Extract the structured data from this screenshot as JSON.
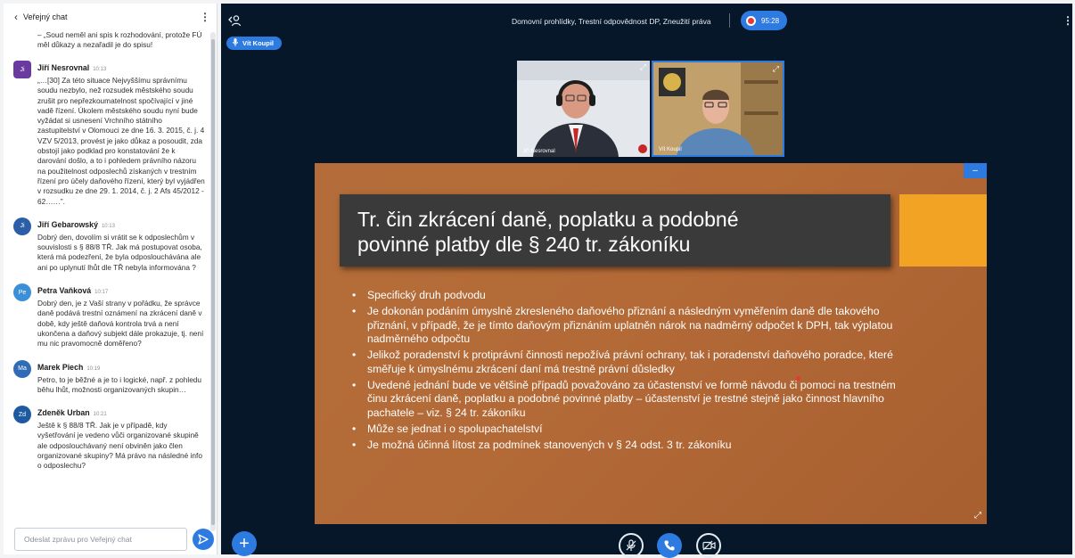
{
  "chat": {
    "title": "Veřejný chat",
    "top_text": "– „Soud neměl ani spis k rozhodování, protože FÚ měl důkazy a nezařadil je do spisu!",
    "messages": [
      {
        "initials": "Ji",
        "name": "Jiří Nesrovnal",
        "time": "10:13",
        "color": "#6b3aa0",
        "text": "„…[30] Za této situace Nejvyššímu správnímu soudu nezbylo, než rozsudek městského soudu zrušit pro nepřezkoumatelnost spočívající v jiné vadě řízení. Úkolem městského soudu nyní bude vyžádat si usnesení Vrchního státního zastupitelství v Olomouci ze dne 16. 3. 2015, č. j. 4 VZV 5/2013, provést je jako důkaz a posoudit, zda obstojí jako podklad pro konstatování že k darování došlo, a to i pohledem právního názoru na použitelnost odposlechů získaných v trestním řízení pro účely daňového řízení, který byl vyjádřen v rozsudku ze dne 29. 1. 2014, č. j. 2 Afs 45/2012 - 62……”."
      },
      {
        "initials": "Ji",
        "name": "Jiří Gebarowský",
        "time": "10:13",
        "color": "#2a5fa8",
        "text": "Dobrý den, dovolím si vrátit se k odposlechům v souvislosti s § 88/8 TŘ. Jak má postupovat osoba, která má podezření, že byla odposlouchávána ale ani po uplynutí lhůt dle TŘ nebyla informována ?"
      },
      {
        "initials": "Pe",
        "name": "Petra Vaňková",
        "time": "10:17",
        "color": "#3a8fd6",
        "text": "Dobrý den, je z Vaší strany v pořádku, že správce daně podává trestní oznámení na zkrácení daně v době, kdy ještě daňová kontrola trvá a není ukončena a daňový subjekt dále prokazuje, tj. není mu nic pravomocně doměřeno?"
      },
      {
        "initials": "Ma",
        "name": "Marek Piech",
        "time": "10:19",
        "color": "#2f6cb5",
        "text": "Petro, to je běžné a je to i logické, např. z pohledu běhu lhůt, možnosti organizovaných skupin…"
      },
      {
        "initials": "Zd",
        "name": "Zdeněk Urban",
        "time": "10:21",
        "color": "#1e5aa0",
        "text": "Ještě k § 88/8 TŘ. Jak je v případě, kdy vyšetřování je vedeno vůči organizované skupině ale odposlouchávaný není obviněn jako člen organizované skupiny? Má právo na následné info o odposlechu?"
      }
    ],
    "input_placeholder": "Odeslat zprávu pro Veřejný chat",
    "icons": {
      "back": "chevron-left-icon",
      "menu": "kebab-menu-icon",
      "send": "send-icon"
    }
  },
  "topbar": {
    "title": "Domovní prohlídky, Trestní odpovědnost DP, Zneužití práva",
    "recording_time": "95:28",
    "talking_user": "Vít Koupil"
  },
  "webcams": [
    {
      "name": "Jiří Nesrovnal"
    },
    {
      "name": "Vít Koupil"
    }
  ],
  "slide": {
    "title_line1": "Tr. čin zkrácení daně, poplatku a podobné",
    "title_line2": "povinné platby dle § 240 tr. zákoníku",
    "bullets": [
      "Specifický druh podvodu",
      "Je dokonán podáním úmyslně zkresleného daňového přiznání a následným vyměřením daně dle takového přiznání, v případě, že je tímto daňovým přiznáním uplatněn nárok na nadměrný odpočet k DPH, tak výplatou nadměrného odpočtu",
      "Jelikož poradenství k protiprávní činnosti nepožívá právní ochrany, tak i poradenství daňového poradce, které směřuje k úmyslnému zkrácení daní má trestně právní důsledky",
      "Uvedené jednání bude ve většině případů považováno za účastenství ve formě návodu či pomoci na trestném činu zkrácení daně, poplatku a podobné povinné platby – účastenství je trestné stejně jako činnost hlavního pachatele – viz. § 24 tr. zákoníku",
      "Může se jednat i o spolupachatelství",
      "Je možná účinná lítost za podmínek stanovených v § 24 odst. 3 tr. zákoníku"
    ],
    "colors": {
      "background": "#b36a37",
      "title_box": "#3a3a3a",
      "accent": "#f3a324"
    }
  },
  "colors": {
    "primary": "#2d7be0",
    "main_bg": "#06172a",
    "recording": "#e53935"
  }
}
